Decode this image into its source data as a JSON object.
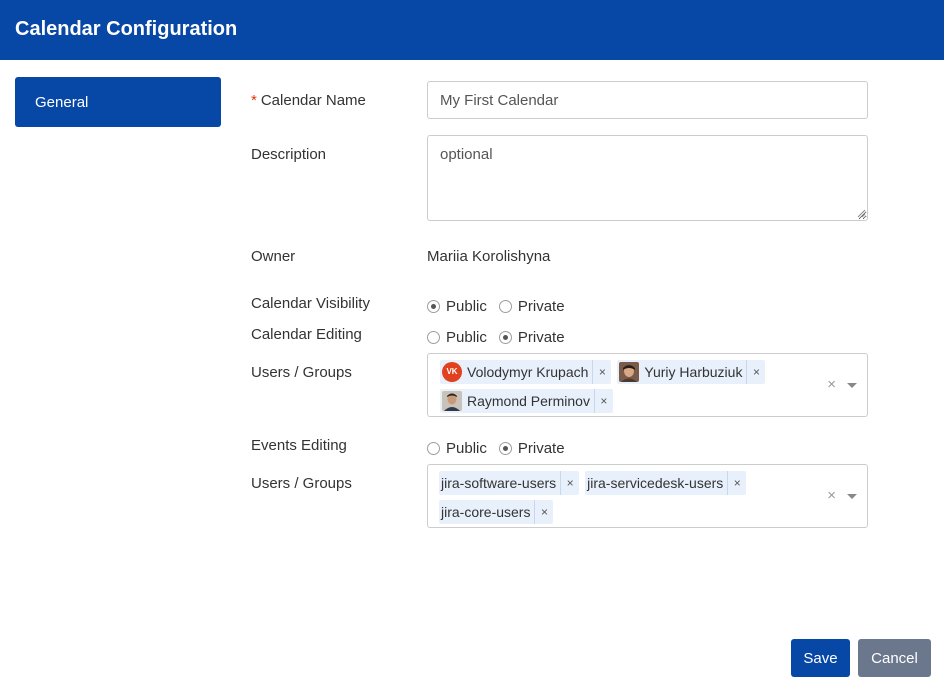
{
  "header": {
    "title": "Calendar Configuration"
  },
  "nav": {
    "general_label": "General"
  },
  "form": {
    "calendar_name": {
      "label": "Calendar Name",
      "required_mark": "*",
      "value": "My First Calendar"
    },
    "description": {
      "label": "Description",
      "placeholder": "optional"
    },
    "owner": {
      "label": "Owner",
      "value": "Mariia Korolishyna"
    },
    "calendar_visibility": {
      "label": "Calendar Visibility",
      "options": [
        "Public",
        "Private"
      ],
      "selected": "Public"
    },
    "calendar_editing": {
      "label": "Calendar Editing",
      "options": [
        "Public",
        "Private"
      ],
      "selected": "Private",
      "users_groups_label": "Users / Groups",
      "users": [
        {
          "name": "Volodymyr Krupach",
          "avatar": "VK"
        },
        {
          "name": "Yuriy Harbuziuk",
          "avatar": "photo"
        },
        {
          "name": "Raymond Perminov",
          "avatar": "photo"
        }
      ]
    },
    "events_editing": {
      "label": "Events Editing",
      "options": [
        "Public",
        "Private"
      ],
      "selected": "Private",
      "users_groups_label": "Users / Groups",
      "groups": [
        "jira-software-users",
        "jira-servicedesk-users",
        "jira-core-users"
      ]
    },
    "chip_remove": "×",
    "clear_glyph": "×"
  },
  "actions": {
    "save_label": "Save",
    "cancel_label": "Cancel"
  },
  "colors": {
    "brand": "#0747a6",
    "cancel": "#6b778c",
    "chip_bg": "#e8f0fb",
    "vk_avatar": "#e0411f",
    "required": "#de350b"
  }
}
